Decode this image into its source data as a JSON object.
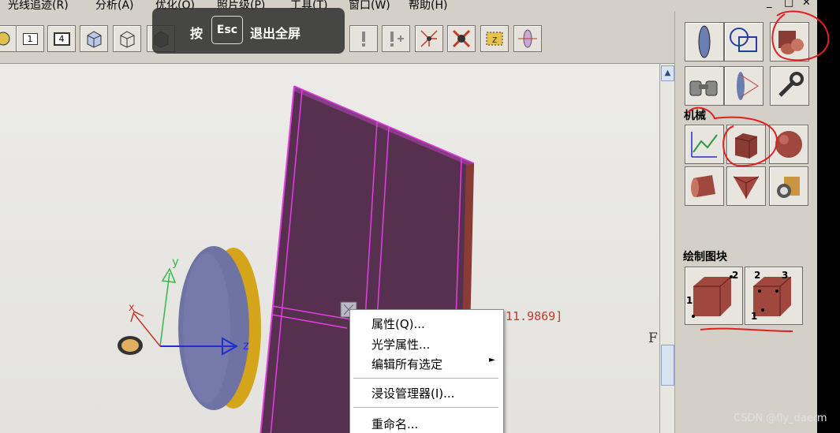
{
  "menu": [
    "光线追迹(R)",
    "分析(A)",
    "优化(O)",
    "照片级(P)",
    "工具(T)",
    "窗口(W)",
    "帮助(H)"
  ],
  "window_controls": [
    "_",
    "□",
    "✕"
  ],
  "fullscreen_hint": {
    "prefix": "按",
    "key": "Esc",
    "suffix": "退出全屏"
  },
  "toolbar": {
    "view_1": "1",
    "view_4": "4"
  },
  "axes": {
    "x": "x",
    "y": "y",
    "z": "z"
  },
  "coordinate_readout": "11.9869]",
  "edge_letter": "F",
  "context_menu": {
    "items": [
      "属性(Q)...",
      "光学属性...",
      "编辑所有选定",
      "浸设管理器(I)...",
      "重命名..."
    ],
    "submenu_arrow": "►"
  },
  "panel": {
    "section1_label": "机械",
    "section2_label": "绘制图块",
    "block1_labels": [
      "2",
      "1"
    ],
    "block2_labels": [
      "2",
      "3",
      "1"
    ]
  },
  "watermark": "CSDN @fly_daerm",
  "colors": {
    "object_face": "#5b2e52",
    "object_edge": "#e040e0",
    "annotation": "#e02020",
    "lens_face": "#6f73a3",
    "lens_rim": "#d4a51a"
  }
}
